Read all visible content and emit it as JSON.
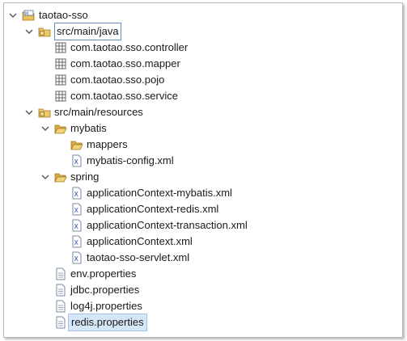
{
  "tree": {
    "project": "taotao-sso",
    "src_java": "src/main/java",
    "packages": [
      "com.taotao.sso.controller",
      "com.taotao.sso.mapper",
      "com.taotao.sso.pojo",
      "com.taotao.sso.service"
    ],
    "src_resources": "src/main/resources",
    "mybatis_folder": "mybatis",
    "mappers_folder": "mappers",
    "mybatis_config": "mybatis-config.xml",
    "spring_folder": "spring",
    "spring_files": [
      "applicationContext-mybatis.xml",
      "applicationContext-redis.xml",
      "applicationContext-transaction.xml",
      "applicationContext.xml",
      "taotao-sso-servlet.xml"
    ],
    "properties": [
      "env.properties",
      "jdbc.properties",
      "log4j.properties",
      "redis.properties"
    ],
    "selected_item": "redis.properties"
  }
}
